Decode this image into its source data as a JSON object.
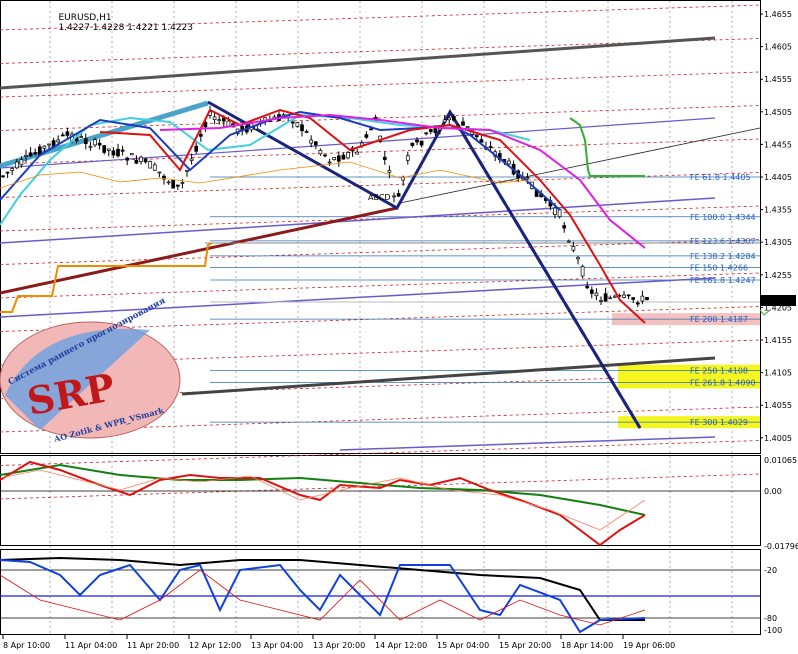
{
  "header": {
    "symbol": "EURUSD,H1",
    "ohlc": "1.4227 1.4228 1.4221 1.4223"
  },
  "price_axis": {
    "ticks": [
      "1.4655",
      "1.4605",
      "1.4555",
      "1.4505",
      "1.4455",
      "1.4405",
      "1.4355",
      "1.4305",
      "1.4255",
      "1.4205",
      "1.4155",
      "1.4105",
      "1.4055",
      "1.4005"
    ],
    "current_price": "1.4223"
  },
  "fib_levels": [
    {
      "label": "FE 61.8 1.4405",
      "highlight": ""
    },
    {
      "label": "FE 100.0 1.4344",
      "highlight": ""
    },
    {
      "label": "FE 123.6 1.4307",
      "highlight": ""
    },
    {
      "label": "FE 138.2 1.4284",
      "highlight": ""
    },
    {
      "label": "FE 150 1.4266",
      "highlight": ""
    },
    {
      "label": "FE 161.8 1.4247",
      "highlight": ""
    },
    {
      "label": "FE 200 1.4187",
      "highlight": "#f4c0c0"
    },
    {
      "label": "FE 250 1.4108",
      "highlight": "#f5f520"
    },
    {
      "label": "FE 261.8 1.4090",
      "highlight": "#f5f520"
    },
    {
      "label": "FE 300 1.4029",
      "highlight": "#f5f520"
    }
  ],
  "indicator1_axis": {
    "top": "0.01065",
    "zero": "0.00",
    "bottom": "-0.01796"
  },
  "indicator2_axis": {
    "upper": "-20",
    "lower": "-80",
    "bottom": "-100"
  },
  "time_axis": [
    "8 Apr 10:00",
    "11 Apr 04:00",
    "11 Apr 20:00",
    "12 Apr 12:00",
    "13 Apr 04:00",
    "13 Apr 20:00",
    "14 Apr 12:00",
    "15 Apr 04:00",
    "15 Apr 20:00",
    "18 Apr 14:00",
    "19 Apr 06:00"
  ],
  "logo": {
    "title_text": "Система раннего прогнозирования",
    "letters": "SRP",
    "credit": "AO Zotik & WPR_VSmark"
  },
  "pattern_marker": "ABCD"
}
